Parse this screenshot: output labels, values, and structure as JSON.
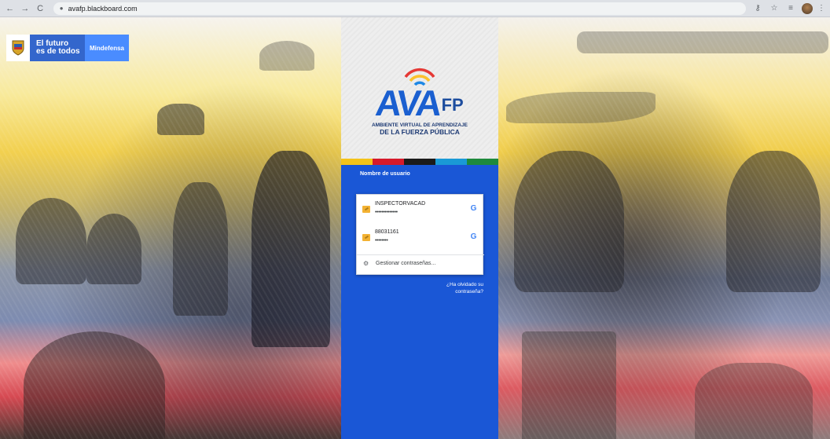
{
  "browser": {
    "url": "avafp.blackboard.com",
    "back_icon": "←",
    "forward_icon": "→",
    "reload_icon": "C",
    "lock_icon": "🔒",
    "key_icon": "⚷",
    "star_icon": "☆",
    "reading_list_icon": "≡",
    "menu_icon": "⋮"
  },
  "gov_badge": {
    "line1": "El futuro",
    "line2": "es de todos",
    "ministry": "Mindefensa"
  },
  "logo": {
    "name": "AVA",
    "suffix": "FP",
    "subtitle1": "AMBIENTE VIRTUAL DE APRENDIZAJE",
    "subtitle2": "DE LA FUERZA PÚBLICA"
  },
  "colorbar": [
    "#f4c319",
    "#d61a2b",
    "#1b1b1b",
    "#1a9ad6",
    "#1e8a3c"
  ],
  "login": {
    "username_label": "Nombre de usuario",
    "saved_credentials": [
      {
        "username": "INSPECTORVACAD",
        "password": "••••••••••••••"
      },
      {
        "username": "88031161",
        "password": "••••••••"
      }
    ],
    "google_icon": "G",
    "manage_label": "Gestionar contraseñas...",
    "forgot_line1": "¿Ha olvidado su",
    "forgot_line2": "contraseña?"
  }
}
